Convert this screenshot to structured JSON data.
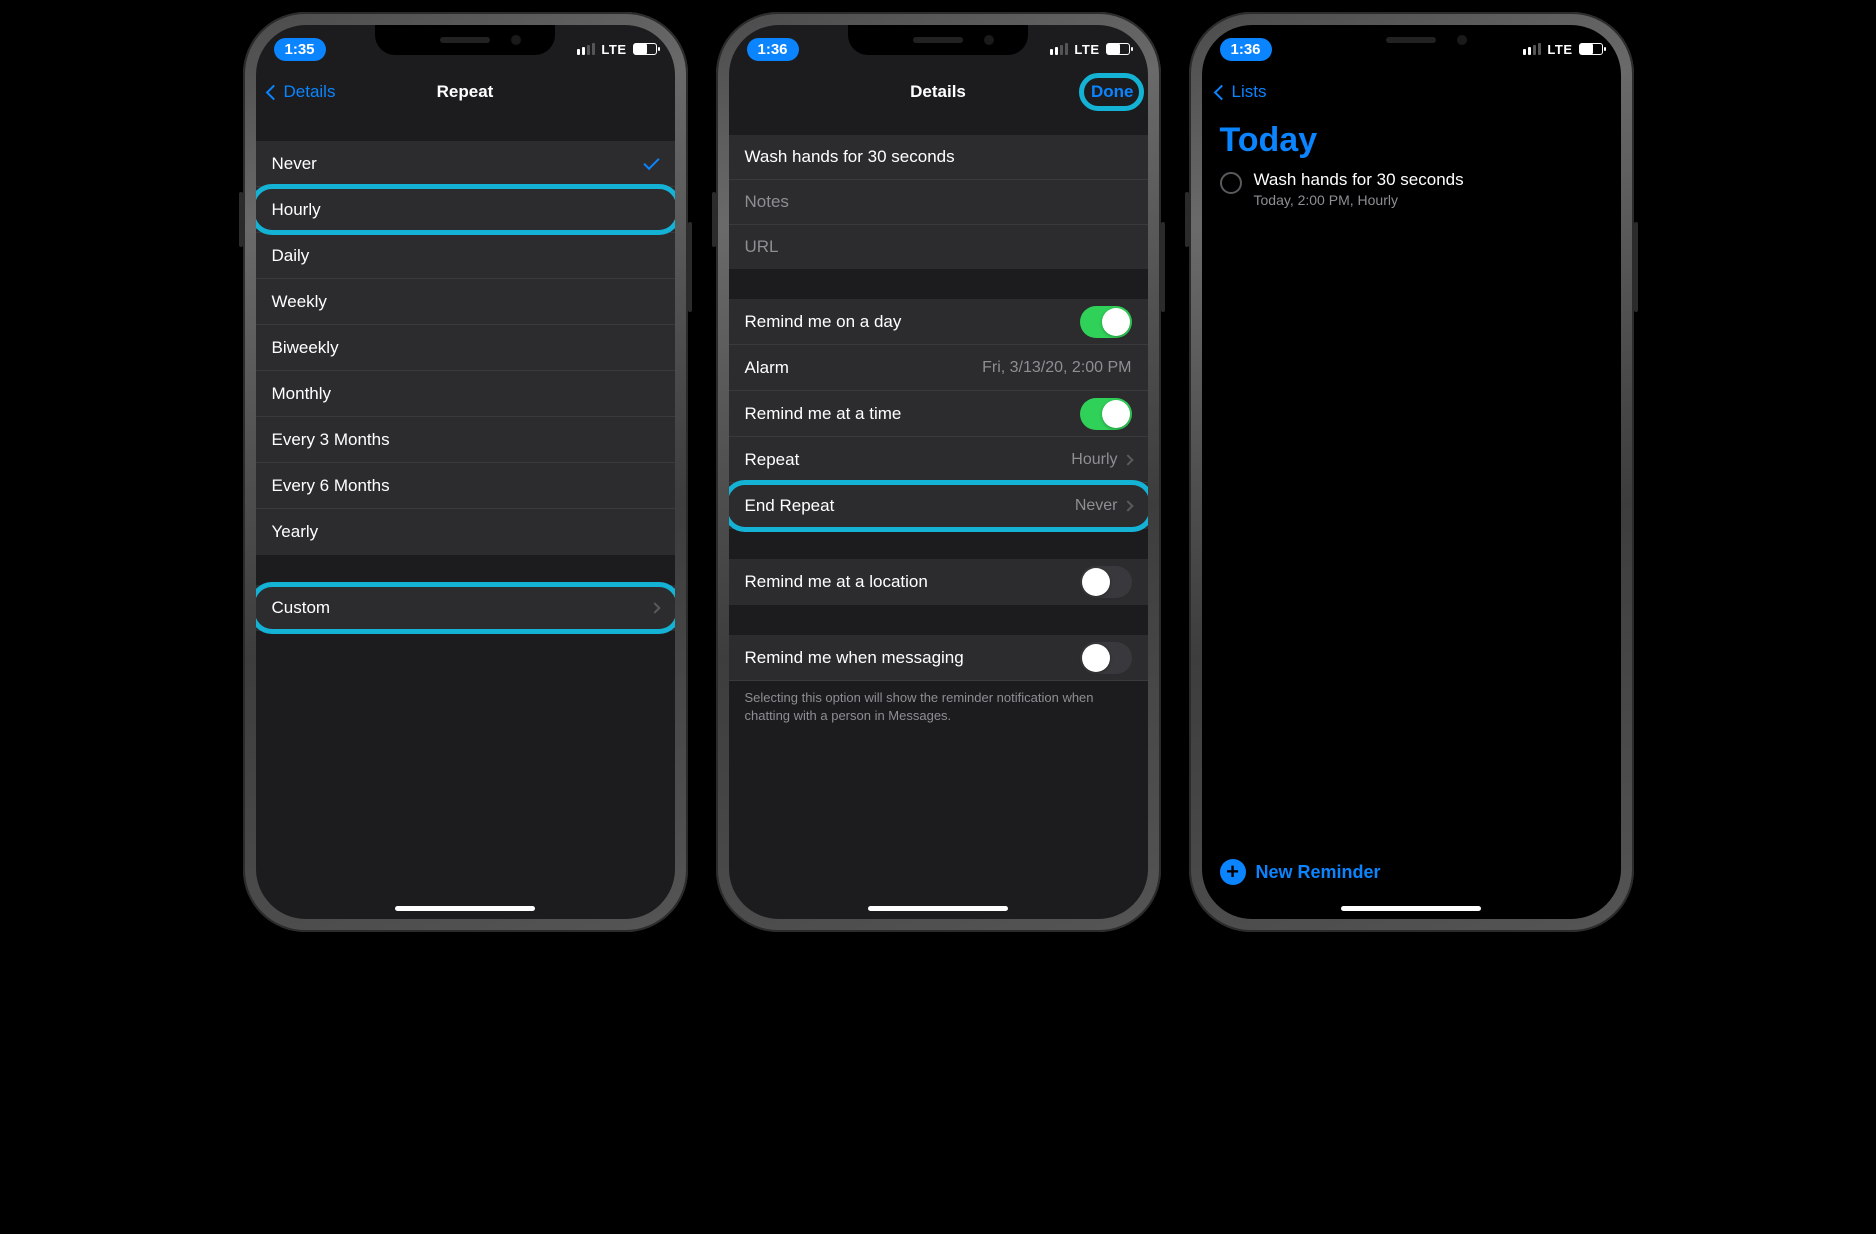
{
  "network_label": "LTE",
  "screen1": {
    "time": "1:35",
    "back_label": "Details",
    "title": "Repeat",
    "options": [
      "Never",
      "Hourly",
      "Daily",
      "Weekly",
      "Biweekly",
      "Monthly",
      "Every 3 Months",
      "Every 6 Months",
      "Yearly"
    ],
    "selected": "Never",
    "custom_label": "Custom"
  },
  "screen2": {
    "time": "1:36",
    "title": "Details",
    "done_label": "Done",
    "reminder_title": "Wash hands for 30 seconds",
    "notes_placeholder": "Notes",
    "url_placeholder": "URL",
    "row_day": "Remind me on a day",
    "row_alarm": "Alarm",
    "alarm_value": "Fri, 3/13/20, 2:00 PM",
    "row_time": "Remind me at a time",
    "row_repeat": "Repeat",
    "repeat_value": "Hourly",
    "row_endrepeat": "End Repeat",
    "endrepeat_value": "Never",
    "row_location": "Remind me at a location",
    "row_messaging": "Remind me when messaging",
    "messaging_footnote": "Selecting this option will show the reminder notification when chatting with a person in Messages."
  },
  "screen3": {
    "time": "1:36",
    "back_label": "Lists",
    "heading": "Today",
    "reminder_title": "Wash hands for 30 seconds",
    "reminder_subtitle": "Today, 2:00 PM, Hourly",
    "new_reminder_label": "New Reminder"
  }
}
